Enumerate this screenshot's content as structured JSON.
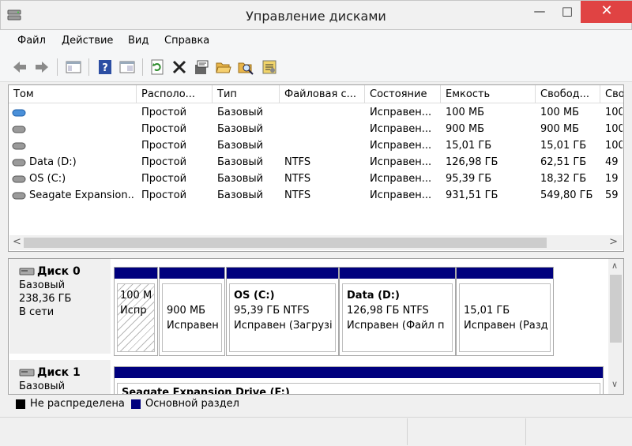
{
  "window": {
    "title": "Управление дисками",
    "minimize": "—",
    "maximize": "□",
    "close": "✕"
  },
  "menu": [
    "Файл",
    "Действие",
    "Вид",
    "Справка"
  ],
  "toolbar_icons": [
    "back-icon",
    "forward-icon",
    "properties-pane-icon",
    "help-icon",
    "details-pane-icon",
    "refresh-icon",
    "delete-icon",
    "properties-icon",
    "open-icon",
    "explore-icon",
    "settings-icon"
  ],
  "columns": [
    "Том",
    "Располо...",
    "Тип",
    "Файловая с...",
    "Состояние",
    "Емкость",
    "Свобод...",
    "Сво"
  ],
  "volumes": [
    {
      "name": "",
      "layout": "Простой",
      "type": "Базовый",
      "fs": "",
      "status": "Исправен...",
      "capacity": "100 МБ",
      "free": "100 МБ",
      "pct": "100",
      "icon": "blue"
    },
    {
      "name": "",
      "layout": "Простой",
      "type": "Базовый",
      "fs": "",
      "status": "Исправен...",
      "capacity": "900 МБ",
      "free": "900 МБ",
      "pct": "100",
      "icon": "gray"
    },
    {
      "name": "",
      "layout": "Простой",
      "type": "Базовый",
      "fs": "",
      "status": "Исправен...",
      "capacity": "15,01 ГБ",
      "free": "15,01 ГБ",
      "pct": "100",
      "icon": "gray"
    },
    {
      "name": "Data (D:)",
      "layout": "Простой",
      "type": "Базовый",
      "fs": "NTFS",
      "status": "Исправен...",
      "capacity": "126,98 ГБ",
      "free": "62,51 ГБ",
      "pct": "49",
      "icon": "gray"
    },
    {
      "name": "OS (C:)",
      "layout": "Простой",
      "type": "Базовый",
      "fs": "NTFS",
      "status": "Исправен...",
      "capacity": "95,39 ГБ",
      "free": "18,32 ГБ",
      "pct": "19",
      "icon": "gray"
    },
    {
      "name": "Seagate Expansion...",
      "layout": "Простой",
      "type": "Базовый",
      "fs": "NTFS",
      "status": "Исправен...",
      "capacity": "931,51 ГБ",
      "free": "549,80 ГБ",
      "pct": "59",
      "icon": "gray"
    }
  ],
  "disks": [
    {
      "name": "Диск 0",
      "type": "Базовый",
      "size": "238,36 ГБ",
      "state": "В сети",
      "partitions": [
        {
          "line1": "100 М",
          "line2": "Испр"
        },
        {
          "line1": "900 МБ",
          "line2": "Исправен"
        },
        {
          "title": "OS  (C:)",
          "line1": "95,39 ГБ NTFS",
          "line2": "Исправен (Загрузі"
        },
        {
          "title": "Data  (D:)",
          "line1": "126,98 ГБ NTFS",
          "line2": "Исправен (Файл п"
        },
        {
          "line1": "15,01 ГБ",
          "line2": "Исправен (Разд"
        }
      ]
    },
    {
      "name": "Диск 1",
      "type": "Базовый",
      "partitions": [
        {
          "title": "Seagate Expansion Drive  (F:)"
        }
      ]
    }
  ],
  "legend": {
    "unallocated": "Не распределена",
    "primary": "Основной раздел",
    "unallocated_color": "#000000",
    "primary_color": "#00007e"
  },
  "colors": {
    "partition_bar": "#00007e",
    "close_button": "#e04343"
  }
}
